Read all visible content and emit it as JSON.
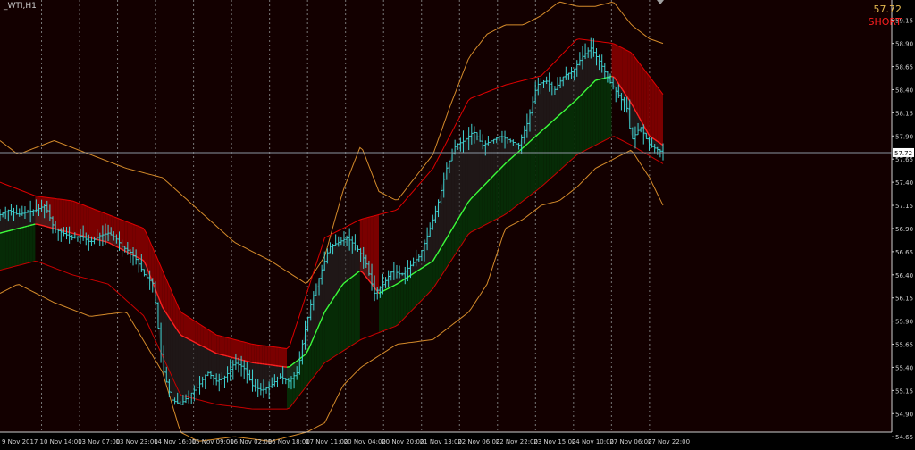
{
  "window": {
    "symbol_title": "_WTI,H1"
  },
  "readout": {
    "price": "57.72",
    "signal": "SHORT"
  },
  "current_price_label": "57.72",
  "colors": {
    "background": "#000000",
    "plot_background": "#130000",
    "grid": "#777777",
    "candle": "#3fd2d2",
    "upper_band": "#e00000",
    "lower_band": "#c80000",
    "mid_up": "#3cff3c",
    "mid_down": "#ff2020",
    "outer_band": "#d48a2a",
    "fill_bull": "#062b06",
    "fill_bear": "#7a0000",
    "inner_fill": "#2a2a2a",
    "axis_text": "#cfcfcf",
    "price_line": "#8a94a0"
  },
  "chart_data": {
    "type": "line",
    "y_axis": {
      "min": 54.7,
      "max": 59.35,
      "ticks": [
        "59.15",
        "58.90",
        "58.65",
        "58.40",
        "58.15",
        "57.90",
        "57.65",
        "57.40",
        "57.15",
        "56.90",
        "56.65",
        "56.40",
        "56.15",
        "55.90",
        "55.65",
        "55.40",
        "55.15",
        "54.90",
        "54.65"
      ]
    },
    "x_axis": {
      "labels": [
        "9 Nov 2017",
        "10 Nov 14:00",
        "13 Nov 07:00",
        "13 Nov 23:00",
        "14 Nov 16:00",
        "15 Nov 09:00",
        "16 Nov 02:00",
        "16 Nov 18:00",
        "17 Nov 11:00",
        "20 Nov 04:00",
        "20 Nov 20:00",
        "21 Nov 13:00",
        "22 Nov 06:00",
        "22 Nov 22:00",
        "23 Nov 15:00",
        "24 Nov 10:00",
        "27 Nov 06:00",
        "27 Nov 22:00"
      ],
      "bar_count": 240
    },
    "grid": "vertical-dotted",
    "current_price": 57.72,
    "series": [
      {
        "key": "price",
        "x": [
          0,
          10,
          20,
          30,
          40,
          50,
          60,
          70,
          80,
          90,
          100,
          110,
          120,
          128,
          136,
          144,
          152,
          160,
          170,
          180,
          190,
          200,
          210,
          220,
          230,
          240,
          250,
          260,
          270,
          280,
          290,
          300,
          310,
          320,
          330,
          336,
          345,
          355,
          365,
          375,
          385,
          395,
          405,
          415,
          425,
          435,
          445,
          455,
          465,
          475,
          485,
          495,
          505,
          515,
          525,
          535,
          545,
          555,
          565,
          575,
          585,
          595,
          605,
          615,
          625,
          635,
          645,
          655,
          665,
          675,
          685,
          695,
          700,
          710,
          720,
          735
        ],
        "y": [
          57.05,
          57.1,
          57.05,
          57.08,
          57.1,
          57.15,
          56.9,
          56.85,
          56.8,
          56.82,
          56.75,
          56.82,
          56.85,
          56.8,
          56.7,
          56.65,
          56.55,
          56.4,
          56.3,
          55.4,
          55.05,
          55.0,
          55.1,
          55.2,
          55.35,
          55.25,
          55.3,
          55.45,
          55.4,
          55.2,
          55.15,
          55.2,
          55.3,
          55.25,
          55.35,
          55.7,
          56.1,
          56.4,
          56.7,
          56.75,
          56.8,
          56.7,
          56.55,
          56.2,
          56.3,
          56.45,
          56.4,
          56.5,
          56.6,
          56.85,
          57.15,
          57.55,
          57.8,
          57.85,
          57.95,
          57.8,
          57.85,
          57.9,
          57.85,
          57.8,
          58.05,
          58.45,
          58.5,
          58.4,
          58.55,
          58.6,
          58.75,
          58.85,
          58.7,
          58.5,
          58.35,
          58.2,
          57.85,
          58.0,
          57.8,
          57.72
        ]
      },
      {
        "key": "upper_band",
        "x": [
          0,
          40,
          80,
          120,
          160,
          200,
          240,
          280,
          320,
          360,
          400,
          440,
          480,
          520,
          560,
          600,
          640,
          680,
          700,
          735
        ],
        "y": [
          57.4,
          57.25,
          57.2,
          57.05,
          56.9,
          56.0,
          55.75,
          55.65,
          55.6,
          56.8,
          57.0,
          57.1,
          57.55,
          58.3,
          58.45,
          58.55,
          58.95,
          58.9,
          58.8,
          58.35
        ]
      },
      {
        "key": "midline",
        "x": [
          0,
          40,
          80,
          120,
          160,
          170,
          180,
          200,
          240,
          280,
          320,
          340,
          360,
          380,
          400,
          420,
          440,
          480,
          520,
          560,
          600,
          640,
          660,
          680,
          700,
          720,
          735
        ],
        "y": [
          56.85,
          56.95,
          56.85,
          56.75,
          56.55,
          56.3,
          56.05,
          55.75,
          55.55,
          55.45,
          55.4,
          55.55,
          56.0,
          56.3,
          56.45,
          56.2,
          56.3,
          56.55,
          57.2,
          57.6,
          57.95,
          58.3,
          58.5,
          58.55,
          58.25,
          57.9,
          57.8
        ]
      },
      {
        "key": "lower_band",
        "x": [
          0,
          40,
          80,
          120,
          160,
          200,
          240,
          280,
          320,
          360,
          400,
          440,
          480,
          520,
          560,
          600,
          640,
          680,
          700,
          735
        ],
        "y": [
          56.45,
          56.55,
          56.4,
          56.3,
          55.95,
          55.1,
          55.0,
          54.95,
          54.95,
          55.45,
          55.7,
          55.85,
          56.25,
          56.85,
          57.05,
          57.35,
          57.7,
          57.9,
          57.8,
          57.6
        ]
      },
      {
        "key": "outer_upper",
        "x": [
          0,
          20,
          60,
          100,
          140,
          180,
          220,
          260,
          300,
          340,
          360,
          380,
          400,
          420,
          440,
          480,
          500,
          520,
          540,
          560,
          580,
          600,
          620,
          640,
          660,
          680,
          700,
          720,
          735
        ],
        "y": [
          57.85,
          57.7,
          57.85,
          57.7,
          57.55,
          57.45,
          57.1,
          56.75,
          56.55,
          56.3,
          56.6,
          57.3,
          57.8,
          57.3,
          57.2,
          57.7,
          58.25,
          58.75,
          59.0,
          59.1,
          59.1,
          59.2,
          59.35,
          59.3,
          59.3,
          59.35,
          59.1,
          58.95,
          58.9
        ]
      },
      {
        "key": "outer_lower",
        "x": [
          0,
          20,
          60,
          100,
          140,
          180,
          200,
          220,
          260,
          300,
          340,
          360,
          380,
          400,
          440,
          480,
          500,
          520,
          540,
          560,
          580,
          600,
          620,
          640,
          660,
          680,
          700,
          720,
          735
        ],
        "y": [
          56.2,
          56.3,
          56.1,
          55.95,
          56.0,
          55.35,
          54.7,
          54.6,
          54.65,
          54.6,
          54.7,
          54.8,
          55.2,
          55.4,
          55.65,
          55.7,
          55.85,
          56.0,
          56.3,
          56.9,
          57.0,
          57.15,
          57.2,
          57.35,
          57.55,
          57.65,
          57.75,
          57.45,
          57.15
        ]
      }
    ]
  }
}
